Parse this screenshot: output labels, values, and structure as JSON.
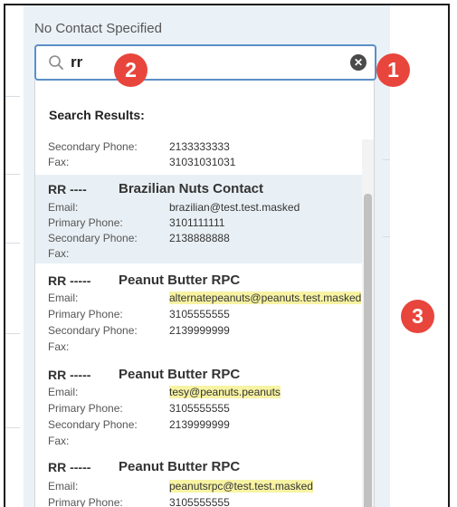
{
  "panel": {
    "header": "No Contact Specified"
  },
  "search": {
    "value": "rr",
    "placeholder": ""
  },
  "results": {
    "title": "Search Results:",
    "partial": {
      "rows": [
        [
          "Secondary Phone:",
          "2133333333"
        ],
        [
          "Fax:",
          "31031031031"
        ]
      ]
    },
    "items": [
      {
        "code": "RR ----",
        "name": "Brazilian Nuts Contact",
        "rows": [
          [
            "Email:",
            "brazilian@test.test.masked"
          ],
          [
            "Primary Phone:",
            "3101111111"
          ],
          [
            "Secondary Phone:",
            "2138888888"
          ],
          [
            "Fax:",
            ""
          ]
        ]
      },
      {
        "code": "RR -----",
        "name": "Peanut Butter RPC",
        "rows": [
          [
            "Email:",
            "alternatepeanuts@peanuts.test.masked"
          ],
          [
            "Primary Phone:",
            "3105555555"
          ],
          [
            "Secondary Phone:",
            "2139999999"
          ],
          [
            "Fax:",
            ""
          ]
        ]
      },
      {
        "code": "RR -----",
        "name": "Peanut Butter RPC",
        "rows": [
          [
            "Email:",
            "tesy@peanuts.peanuts"
          ],
          [
            "Primary Phone:",
            "3105555555"
          ],
          [
            "Secondary Phone:",
            "2139999999"
          ],
          [
            "Fax:",
            ""
          ]
        ]
      },
      {
        "code": "RR -----",
        "name": "Peanut Butter RPC",
        "rows": [
          [
            "Email:",
            "peanutsrpc@test.test.masked"
          ],
          [
            "Primary Phone:",
            "3105555555"
          ]
        ]
      }
    ]
  },
  "badges": [
    "1",
    "2",
    "3"
  ],
  "colors": {
    "badge": "#e8453c",
    "highlight": "#f7f3a3",
    "search_border": "#5b8fc7"
  }
}
